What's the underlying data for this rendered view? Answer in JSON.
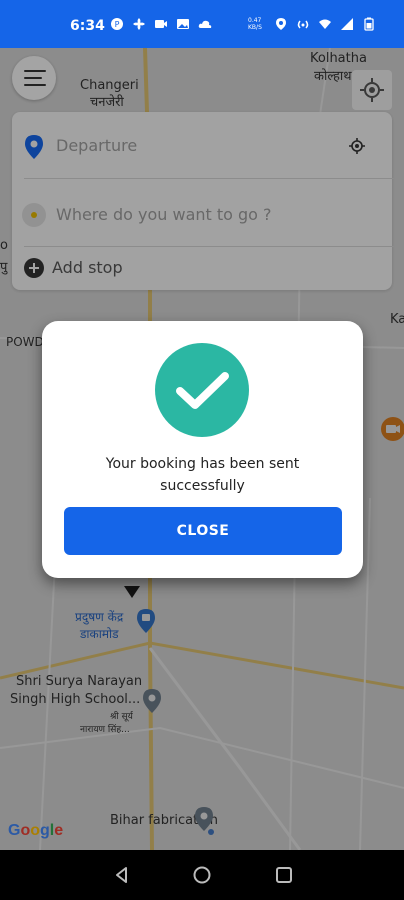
{
  "status_bar": {
    "time": "6:34",
    "data_speed": "0.47 KB/S"
  },
  "map": {
    "labels": {
      "kolhatha_en": "Kolhatha",
      "kolhatha_hi": "कोल्हाथ",
      "changeri_en": "Changeri",
      "changeri_hi": "चनजेरी",
      "powd": "POWD",
      "ka": "Ka",
      "pu": "पु",
      "o": "o",
      "pradushan_1": "प्रदुषण केंद्र",
      "pradushan_2": "डाकामोड",
      "school_1": "Shri Surya Narayan",
      "school_2": "Singh High School...",
      "school_hi_1": "श्री सूर्य",
      "school_hi_2": "नारायण सिंह...",
      "bihar": "Bihar fabrication"
    },
    "google_logo": "Google"
  },
  "search": {
    "departure_placeholder": "Departure",
    "destination_placeholder": "Where do you want to go ?",
    "add_stop_label": "Add stop"
  },
  "dialog": {
    "message_line1": "Your booking has been sent",
    "message_line2": "successfully",
    "close_label": "CLOSE"
  },
  "colors": {
    "primary": "#1565e8",
    "success": "#2bb7a3"
  }
}
